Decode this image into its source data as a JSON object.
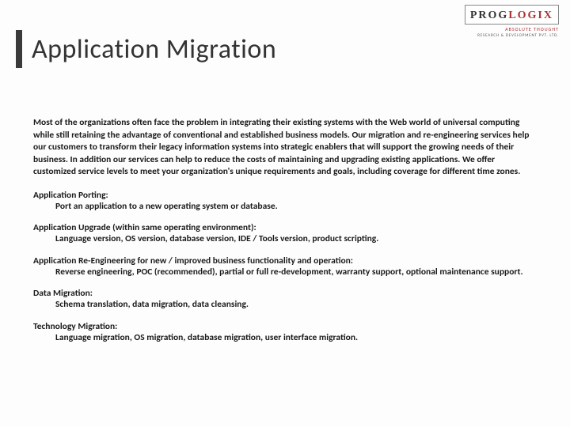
{
  "logo": {
    "name_part1": "PROG",
    "name_part2": "LOGIX",
    "tagline": "ABSOLUTE THOUGHT",
    "subline": "RESEARCH & DEVELOPMENT PVT. LTD."
  },
  "title": "Application Migration",
  "intro": "Most of the organizations often face the problem in integrating their existing systems with the Web world of universal computing while still retaining the advantage of conventional and established business models. Our migration and re-engineering services help our customers to transform their legacy information systems into strategic enablers that will support the growing needs of their business. In addition our services can help to reduce the costs of maintaining and upgrading existing applications. We offer customized service levels to meet your organization's unique requirements and goals, including coverage for different time zones.",
  "sections": [
    {
      "heading": "Application Porting:",
      "body": "Port an application to a new operating system or database."
    },
    {
      "heading": "Application Upgrade (within same operating environment):",
      "body": "Language version, OS version, database version, IDE / Tools version, product scripting."
    },
    {
      "heading": "Application Re-Engineering for new / improved business functionality and operation:",
      "body": "Reverse engineering, POC (recommended), partial or full re-development, warranty support, optional maintenance support."
    },
    {
      "heading": "Data Migration:",
      "body": "Schema translation, data migration, data cleansing."
    },
    {
      "heading": "Technology Migration:",
      "body": "Language migration, OS migration, database migration, user interface migration."
    }
  ]
}
